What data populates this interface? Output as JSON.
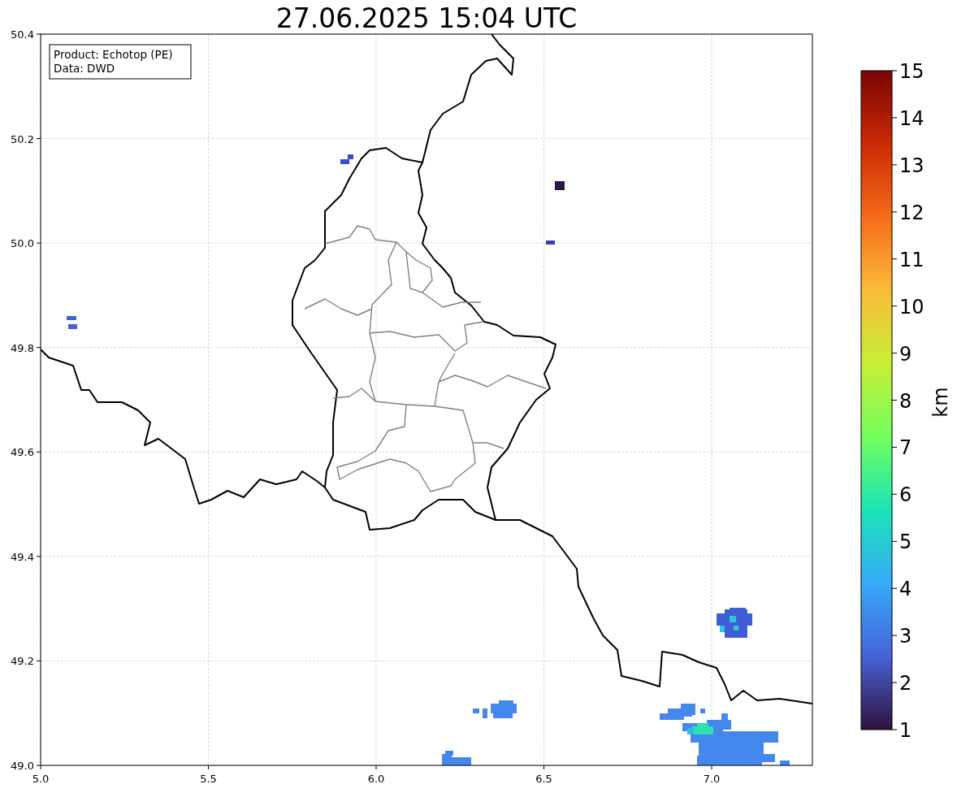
{
  "title": "27.06.2025 15:04 UTC",
  "info_box": {
    "lines": [
      "Product: Echotop (PE)",
      "Data: DWD"
    ]
  },
  "x_axis": {
    "ticks": [
      "5.0",
      "5.5",
      "6.0",
      "6.5",
      "7.0"
    ]
  },
  "y_axis": {
    "ticks": [
      "50.4",
      "50.2",
      "50.0",
      "49.8",
      "49.6",
      "49.4",
      "49.2",
      "49.0"
    ]
  },
  "colorbar": {
    "label": "km",
    "ticks": [
      "15",
      "14",
      "13",
      "12",
      "11",
      "10",
      "9",
      "8",
      "7",
      "6",
      "5",
      "4",
      "3",
      "2",
      "1"
    ]
  }
}
